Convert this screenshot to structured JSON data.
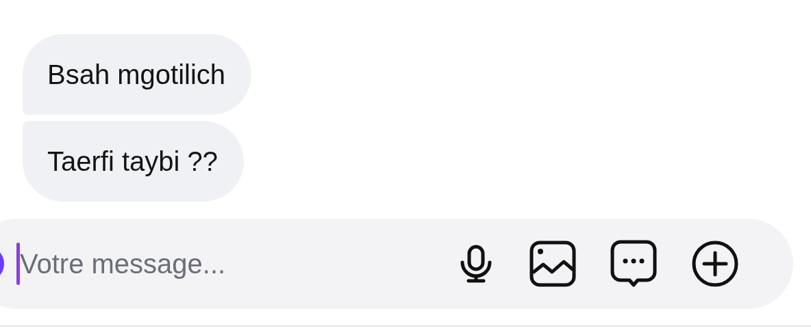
{
  "messages": [
    {
      "text": "Bsah mgotilich",
      "kind": "first"
    },
    {
      "text": "Taerfi taybi ??",
      "kind": "last"
    }
  ],
  "composer": {
    "placeholder": "Votre message...",
    "focused": true
  }
}
